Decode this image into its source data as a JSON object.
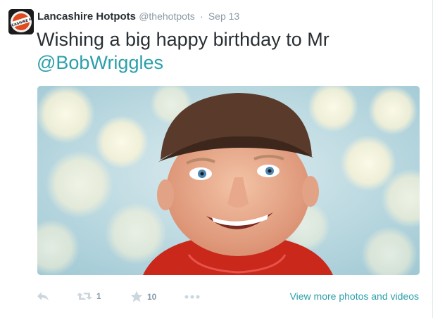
{
  "tweet": {
    "fullname": "Lancashire Hotpots",
    "handle": "@thehotpots",
    "separator": "·",
    "time": "Sep 13",
    "text_prefix": "Wishing a big happy birthday to Mr",
    "mention": "@BobWriggles",
    "avatar_text": "THE LANCASHIRE HOTPOTS"
  },
  "media": {
    "description_icon": "photo"
  },
  "actions": {
    "reply_icon": "reply-icon",
    "retweet_icon": "retweet-icon",
    "retweet_count": "1",
    "favorite_icon": "star-icon",
    "favorite_count": "10",
    "more_icon": "more-dots-icon",
    "view_more_label": "View more photos and videos"
  },
  "colors": {
    "name": "#292f33",
    "meta": "#8899a6",
    "link": "#2b9fa9"
  }
}
